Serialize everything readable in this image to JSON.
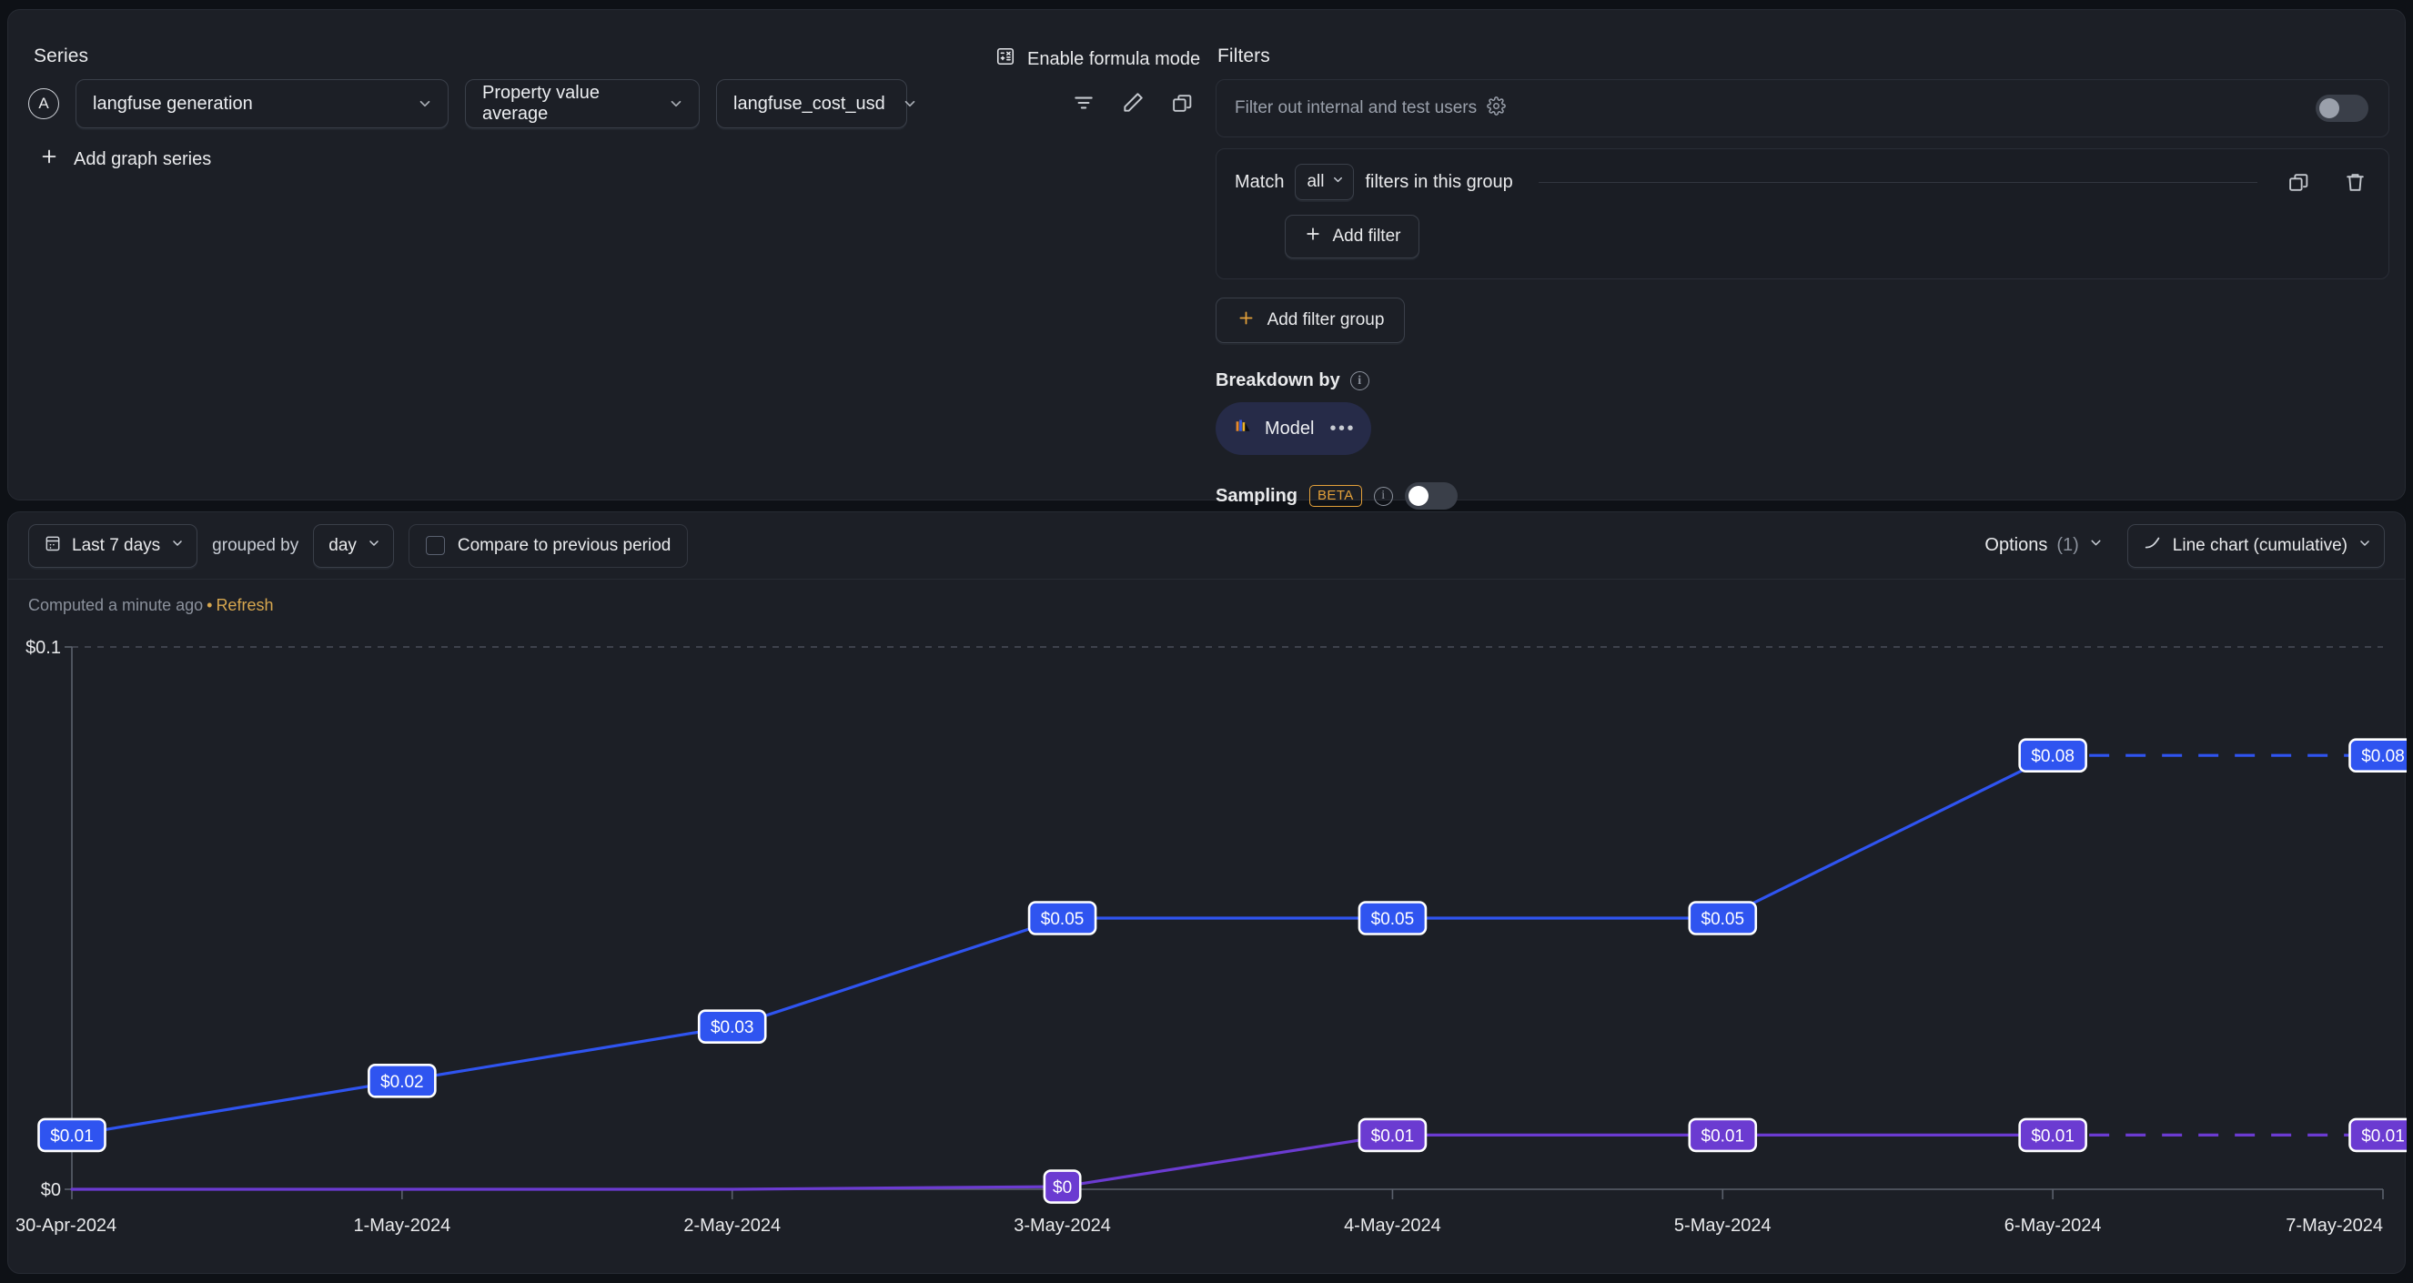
{
  "series_panel": {
    "title": "Series",
    "badge": "A",
    "metric_select": "langfuse generation",
    "aggregation_select": "Property value average",
    "property_select": "langfuse_cost_usd",
    "add_series_label": "Add graph series",
    "formula_mode_label": "Enable formula mode",
    "icons": [
      "filter-icon",
      "edit-icon",
      "duplicate-icon",
      "delete-icon"
    ]
  },
  "filters_panel": {
    "title": "Filters",
    "internal_users_label": "Filter out internal and test users",
    "internal_users_toggle": "off",
    "match_label": "Match",
    "match_value": "all",
    "match_suffix": "filters in this group",
    "add_filter_label": "Add filter",
    "add_filter_group_label": "Add filter group",
    "breakdown_label": "Breakdown by",
    "breakdown_chip": "Model",
    "sampling_label": "Sampling",
    "sampling_badge": "BETA",
    "sampling_toggle": "off"
  },
  "chart_toolbar": {
    "date_range": "Last 7 days",
    "grouped_by_label": "grouped by",
    "granularity": "day",
    "compare_label": "Compare to previous period",
    "compare_checked": false,
    "options_label": "Options",
    "options_count": "(1)",
    "chart_type": "Line chart (cumulative)"
  },
  "status": {
    "computed_text": "Computed a minute ago",
    "separator": "•",
    "refresh_label": "Refresh"
  },
  "colors": {
    "series_blue": "#2f54f0",
    "series_purple": "#6b3bd1",
    "accent_amber": "#e4a13a",
    "panel_bg": "#1c1f26",
    "page_bg": "#0e1116"
  },
  "chart_data": {
    "type": "line",
    "title": "",
    "xlabel": "",
    "ylabel": "",
    "cumulative": true,
    "grid": true,
    "legend": "none",
    "ylim": [
      0,
      0.1
    ],
    "ytick_labels": [
      "$0",
      "$0.1"
    ],
    "ytick_values": [
      0,
      0.1
    ],
    "categories": [
      "30-Apr-2024",
      "1-May-2024",
      "2-May-2024",
      "3-May-2024",
      "4-May-2024",
      "5-May-2024",
      "6-May-2024",
      "7-May-2024"
    ],
    "series": [
      {
        "name": "series-blue",
        "color": "#2f54f0",
        "values": [
          0.01,
          0.02,
          0.03,
          0.05,
          0.05,
          0.05,
          0.08,
          0.08
        ],
        "labels": [
          "$0.01",
          "$0.02",
          "$0.03",
          "$0.05",
          "$0.05",
          "$0.05",
          "$0.08",
          "$0.08"
        ],
        "dashed_from_index": 6
      },
      {
        "name": "series-purple",
        "color": "#6b3bd1",
        "values": [
          0,
          0,
          0,
          0.0005,
          0.01,
          0.01,
          0.01,
          0.01
        ],
        "labels": [
          "",
          "",
          "",
          "$0",
          "$0.01",
          "$0.01",
          "$0.01",
          "$0.01"
        ],
        "dashed_from_index": 6
      }
    ]
  }
}
